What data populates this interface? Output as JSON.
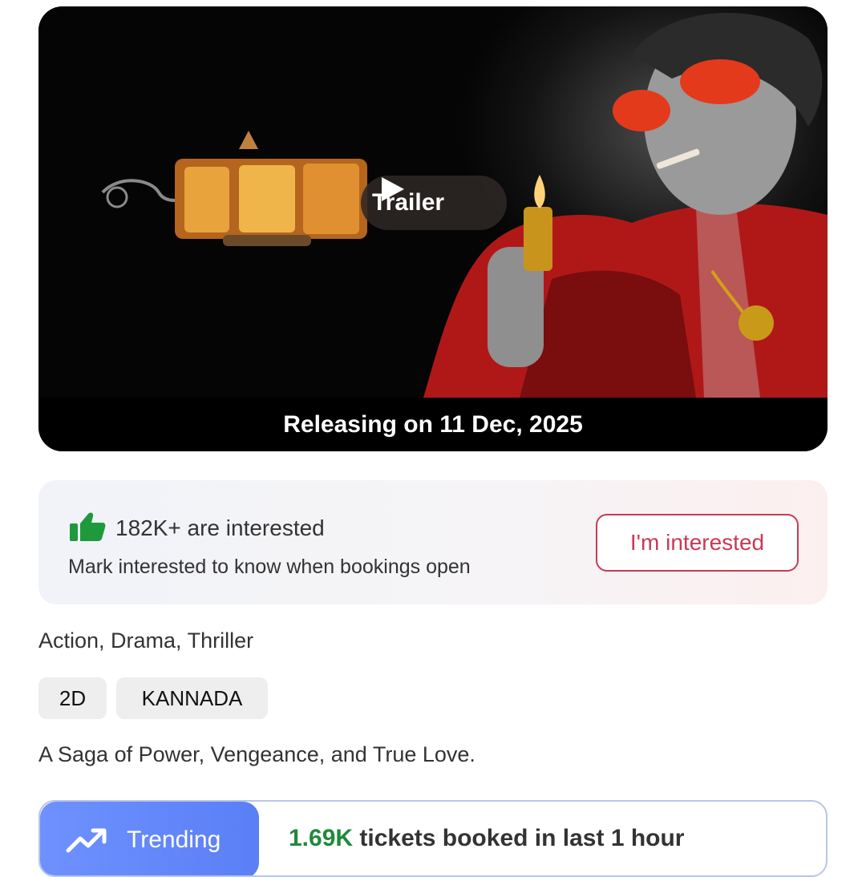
{
  "banner": {
    "trailer_label": "Trailer",
    "release_text": "Releasing on 11 Dec, 2025"
  },
  "interest": {
    "count_text": "182K+ are interested",
    "subtext": "Mark interested to know when bookings open",
    "button_label": "I'm interested"
  },
  "genres": "Action, Drama, Thriller",
  "tags": [
    "2D",
    "KANNADA"
  ],
  "tagline": "A Saga of Power, Vengeance, and True Love.",
  "trending": {
    "badge_label": "Trending",
    "count": "1.69K",
    "stat_text": " tickets booked in last 1 hour"
  },
  "colors": {
    "accent_red": "#c83a55",
    "trending_blue": "#5a7ff6",
    "count_green": "#1f8a3a",
    "thumb_green": "#1e9a3c"
  },
  "icons": {
    "play": "play-icon",
    "thumb": "thumbs-up-icon",
    "trend": "trending-up-icon"
  }
}
